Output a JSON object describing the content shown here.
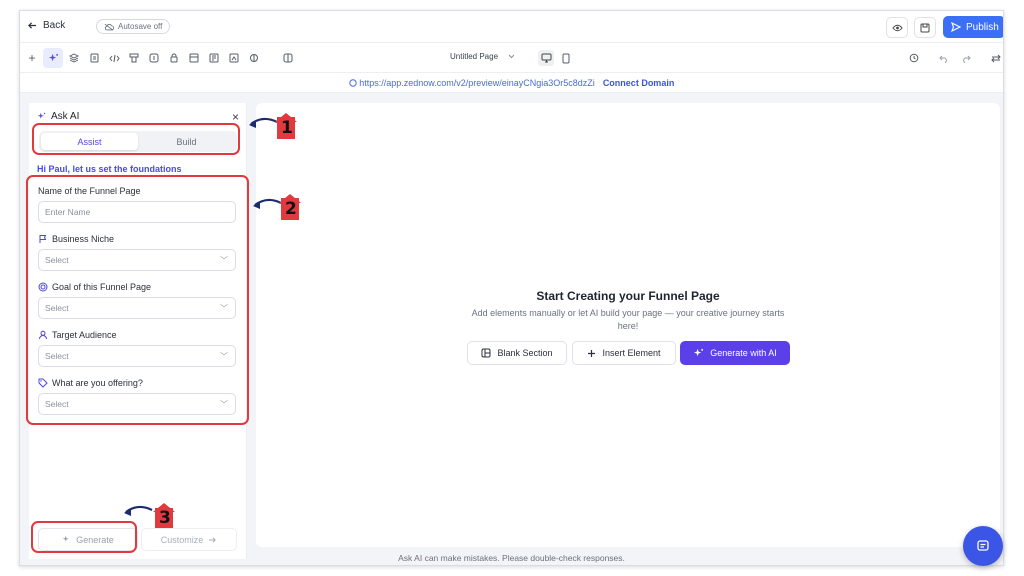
{
  "topbar": {
    "back_label": "Back",
    "autosave_label": "Autosave off",
    "publish_label": "Publish"
  },
  "toolbar": {
    "page_name": "Untitled Page"
  },
  "urlbar": {
    "url": "https://app.zednow.com/v2/preview/einayCNgia3Or5c8dzZi",
    "connect_label": "Connect Domain"
  },
  "panel": {
    "title": "Ask AI",
    "tabs": [
      {
        "label": "Assist",
        "active": true
      },
      {
        "label": "Build",
        "active": false
      }
    ],
    "greeting": "Hi Paul, let us set the foundations",
    "fields": [
      {
        "label": "Name of the Funnel Page",
        "placeholder": "Enter Name",
        "type": "text",
        "icon": ""
      },
      {
        "label": "Business Niche",
        "placeholder": "Select",
        "type": "select",
        "icon": "flag-icon"
      },
      {
        "label": "Goal of this Funnel Page",
        "placeholder": "Select",
        "type": "select",
        "icon": "target-icon"
      },
      {
        "label": "Target Audience",
        "placeholder": "Select",
        "type": "select",
        "icon": "user-icon"
      },
      {
        "label": "What are you offering?",
        "placeholder": "Select",
        "type": "select",
        "icon": "tag-icon"
      }
    ],
    "generate_label": "Generate",
    "customize_label": "Customize"
  },
  "canvas": {
    "title": "Start Creating your Funnel Page",
    "subtitle": "Add elements manually or let AI build your page — your creative journey starts here!",
    "blank_label": "Blank Section",
    "insert_label": "Insert Element",
    "generate_ai_label": "Generate with AI"
  },
  "disclaimer": "Ask AI can make mistakes. Please double-check responses.",
  "annotations": [
    "1",
    "2",
    "3"
  ],
  "colors": {
    "accent": "#5b3fe8",
    "publish": "#3b6ff5",
    "callout": "#e0393e"
  }
}
